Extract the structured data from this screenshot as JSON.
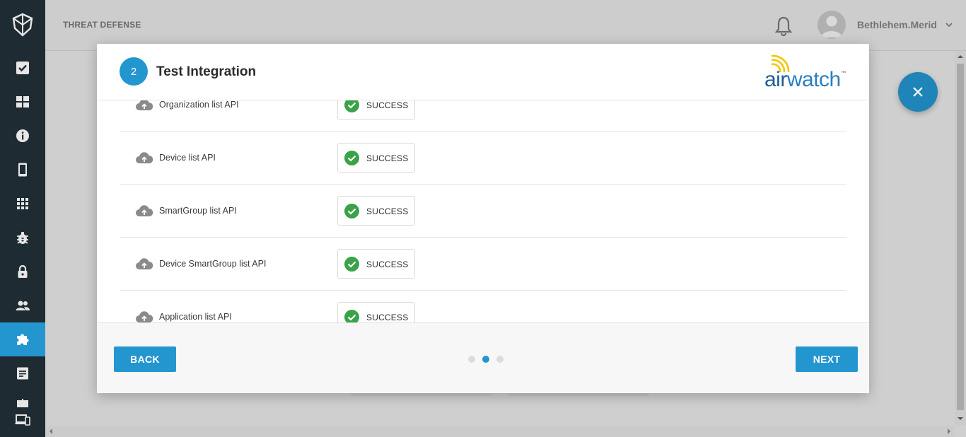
{
  "app": {
    "title": "THREAT DEFENSE"
  },
  "user": {
    "name": "Bethlehem.Merid"
  },
  "sidebar": {
    "items": [
      {
        "icon": "checkbox-icon"
      },
      {
        "icon": "dashboard-icon"
      },
      {
        "icon": "info-icon"
      },
      {
        "icon": "device-icon"
      },
      {
        "icon": "apps-grid-icon"
      },
      {
        "icon": "bug-icon"
      },
      {
        "icon": "lock-icon"
      },
      {
        "icon": "users-icon"
      },
      {
        "icon": "puzzle-icon",
        "active": true
      },
      {
        "icon": "report-icon"
      },
      {
        "icon": "devices-icon"
      }
    ]
  },
  "modal": {
    "step_number": "2",
    "title": "Test Integration",
    "brand": {
      "part1": "air",
      "part2": "watch",
      "tm": "™"
    },
    "rows": [
      {
        "name": "Organization list API",
        "status": "SUCCESS"
      },
      {
        "name": "Device list API",
        "status": "SUCCESS"
      },
      {
        "name": "SmartGroup list API",
        "status": "SUCCESS"
      },
      {
        "name": "Device SmartGroup list API",
        "status": "SUCCESS"
      },
      {
        "name": "Application list API",
        "status": "SUCCESS"
      }
    ],
    "footer": {
      "back_label": "BACK",
      "next_label": "NEXT",
      "steps_total": 3,
      "current_step": 2
    }
  },
  "colors": {
    "accent": "#2396d0",
    "sidebar": "#1f2b33",
    "success": "#3aa348"
  }
}
